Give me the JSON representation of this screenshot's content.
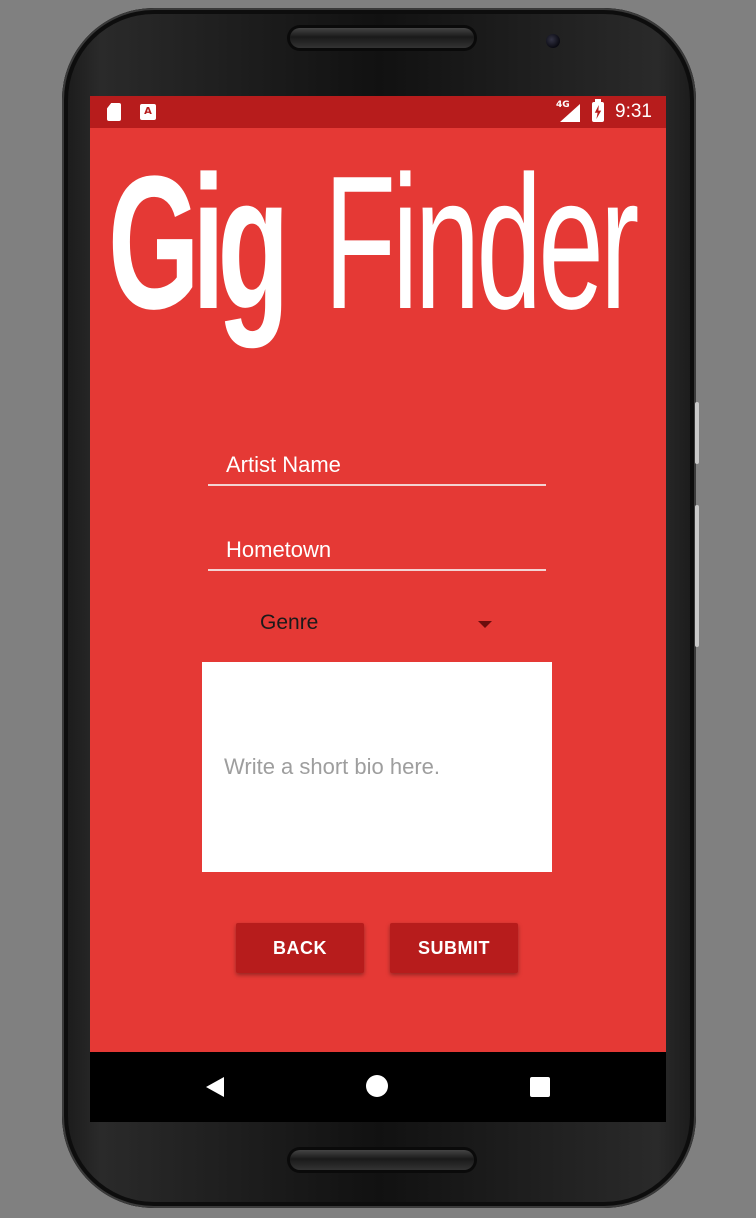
{
  "status_bar": {
    "network": "4G",
    "time": "9:31"
  },
  "logo": {
    "bold_part": "Gig",
    "light_part": "Finder"
  },
  "form": {
    "artist_name_placeholder": "Artist Name",
    "hometown_placeholder": "Hometown",
    "genre_label": "Genre",
    "bio_placeholder": "Write a short bio here."
  },
  "buttons": {
    "back_label": "BACK",
    "submit_label": "SUBMIT"
  },
  "icons": {
    "status_left": [
      "sd-card-icon",
      "app-notification-icon"
    ],
    "status_right": [
      "signal-icon",
      "battery-charging-icon"
    ],
    "nav": [
      "nav-back-icon",
      "nav-home-icon",
      "nav-recents-icon"
    ]
  },
  "colors": {
    "background": "#E53935",
    "status_bar": "#B71C1C",
    "button": "#B71C1C"
  }
}
